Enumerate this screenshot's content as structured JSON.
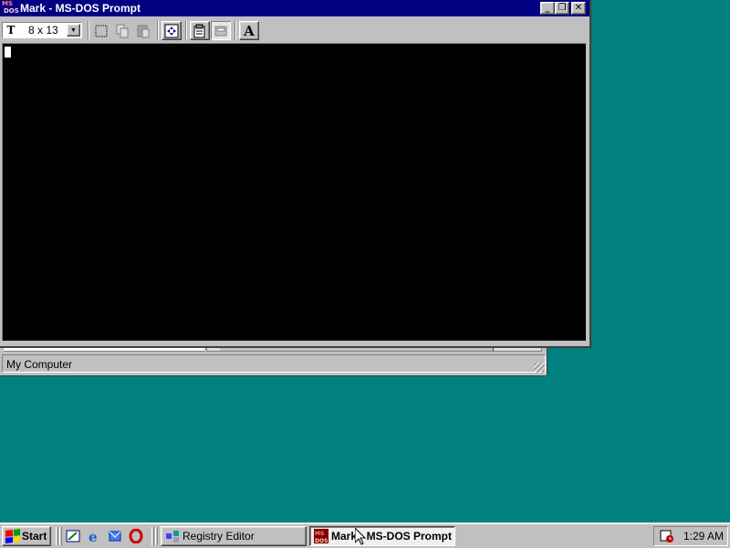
{
  "desktop": {
    "background_color": "#008080"
  },
  "background_window": {
    "app": "Registry Editor",
    "status_text": "My Computer"
  },
  "dos_window": {
    "title": "Mark - MS-DOS Prompt",
    "icon_text_top": "MS",
    "icon_text_bottom": "DOS",
    "title_buttons": {
      "minimize": "_",
      "restore": "❐",
      "close": "✕"
    },
    "toolbar": {
      "font_size_value": "8 x 13",
      "font_icon": "T",
      "dropdown_arrow": "▼",
      "mark_icon": "mark-icon",
      "copy_icon": "copy-icon",
      "paste_icon": "paste-icon",
      "fullscreen_icon": "fullscreen-icon",
      "properties_icon": "properties-icon",
      "background_icon": "background-icon",
      "font_button_label": "A"
    },
    "console": {
      "background": "#000000",
      "cursor_color": "#ffffff"
    }
  },
  "taskbar": {
    "start_label": "Start",
    "quick_launch": [
      "desktop-icon",
      "ie-icon",
      "outlook-icon",
      "opera-icon"
    ],
    "tasks": [
      {
        "label": "Registry Editor",
        "active": false,
        "icon": "registry-icon"
      },
      {
        "label": "Mark - MS-DOS Prompt",
        "active": true,
        "icon": "msdos-icon"
      }
    ],
    "tray": {
      "icon": "scheduler-icon",
      "clock": "1:29 AM"
    }
  },
  "colors": {
    "titlebar_active": "#000080",
    "face": "#c0c0c0",
    "flag_red": "#ff0000",
    "flag_green": "#00a000",
    "flag_blue": "#0000ff",
    "flag_yellow": "#ffd700"
  }
}
